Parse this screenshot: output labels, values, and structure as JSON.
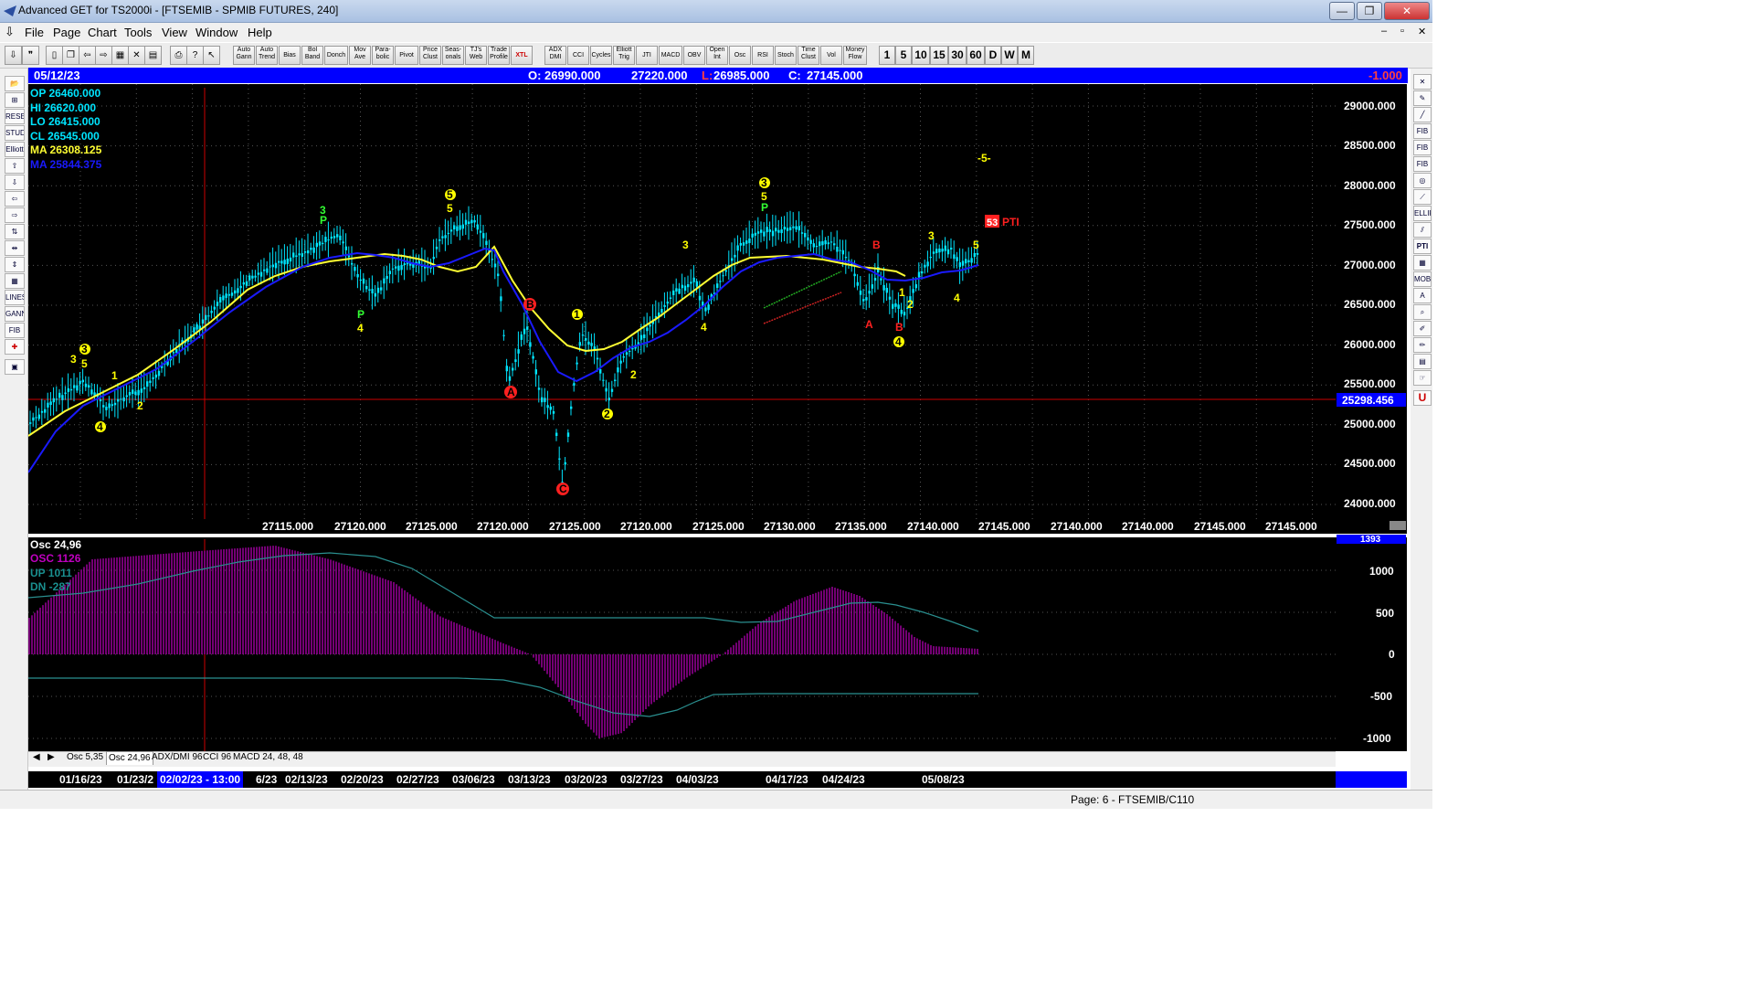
{
  "window": {
    "title": "Advanced GET for TS2000i - [FTSEMIB - SPMIB FUTURES, 240]",
    "buttons": {
      "minimize": "—",
      "maximize": "❐",
      "close": "✕"
    },
    "mdi_buttons": {
      "minimize": "–",
      "restore": "▫",
      "close": "✕"
    }
  },
  "menu": [
    "File",
    "Page",
    "Chart",
    "Tools",
    "View",
    "Window",
    "Help"
  ],
  "toolbar": {
    "indicators": [
      "Auto Gann",
      "Auto Trend",
      "Bias",
      "Bol Band",
      "Donch",
      "Mov Ave",
      "Para- bolic",
      "Pivot",
      "Price Clust",
      "Seas- onals",
      "TJ's Web",
      "Trade Profile",
      "XTL"
    ],
    "oscillators": [
      "ADX DMI",
      "CCI",
      "Cycles",
      "Elliott Trig",
      "JTI",
      "MACD",
      "OBV",
      "Open Int",
      "Osc",
      "RSI",
      "Stoch",
      "Time Clust",
      "Vol",
      "Money Flow"
    ],
    "intervals": [
      "1",
      "5",
      "10",
      "15",
      "30",
      "60",
      "D",
      "W",
      "M"
    ]
  },
  "left_tools": [
    "RESET",
    "STUDY",
    "Elliott",
    "LINES",
    "GANN",
    "FIB"
  ],
  "right_tools": [
    "FIB RET",
    "FIB EXT",
    "FIB TIME",
    "ELLIPS",
    "PTI",
    "MOB"
  ],
  "infobar": {
    "date": "05/12/23",
    "open_label": "O:",
    "open": "26990.000",
    "high": "27220.000",
    "low_label": "L:",
    "low": "26985.000",
    "close_label": "C:",
    "close": "27145.000",
    "change": "-1.000"
  },
  "legend": {
    "op": "OP  26460.000",
    "hi": "HI   26620.000",
    "lo": "LO   26415.000",
    "cl": "CL   26545.000",
    "ma1": "MA  26308.125",
    "ma2": "MA  25844.375"
  },
  "colors": {
    "background": "#000000",
    "candle": "#00e5ff",
    "ma_fast": "#ffff33",
    "ma_slow": "#1a1aff",
    "label_yellow": "#ffff00",
    "label_green": "#33ff33",
    "label_red": "#ff2020",
    "osc": "#c000c0",
    "osc_line": "#2a8f8f",
    "cursor": "#cc0000",
    "axis_text": "#ffffff"
  },
  "price_axis": {
    "ticks": [
      "29000.000",
      "28500.000",
      "28000.000",
      "27500.000",
      "27000.000",
      "26500.000",
      "26000.000",
      "25500.000",
      "25000.000",
      "24500.000",
      "24000.000"
    ],
    "cursor_price": "25298.456"
  },
  "bottom_values": [
    "27115.000",
    "27120.000",
    "27125.000",
    "27120.000",
    "27125.000",
    "27120.000",
    "27125.000",
    "27130.000",
    "27135.000",
    "27140.000",
    "27145.000",
    "27140.000",
    "27140.000",
    "27145.000",
    "27145.000"
  ],
  "wave_labels": {
    "w3a": "3",
    "w5a": "5",
    "w3a_c": "3",
    "w1a": "1",
    "w4a": "4",
    "w2a": "2",
    "w3b": "3",
    "pb": "P",
    "pb2": "P",
    "w4b": "4",
    "w5b_c": "5",
    "w5b": "5",
    "bB": "B",
    "aA": "A",
    "cC": "C",
    "w1b": "1",
    "w2b": "2",
    "w2b_c": "2",
    "w3c": "3",
    "w4c": "4",
    "w3d_c": "3",
    "w5d": "5",
    "pd": "P",
    "bA": "A",
    "bB2": "B",
    "w1c": "1",
    "w2c": "2",
    "bB3": "B",
    "w4c_c": "4",
    "w3e": "3",
    "w5e": "5",
    "w4e": "4",
    "w5_target": "-5-",
    "pti_num": "53",
    "pti": "PTI"
  },
  "osc": {
    "title": "Osc 24,96",
    "osc_label": "OSC 1126",
    "up_label": "UP   1011",
    "dn_label": "DN   -287",
    "ticks": [
      "1000",
      "500",
      "0",
      "-500",
      "-1000"
    ],
    "top_value": "1393"
  },
  "tabs": [
    "Osc 5,35",
    "Osc 24,96",
    "ADX/DMI 96",
    "CCI 96",
    "MACD 24, 48, 48"
  ],
  "dates": [
    "01/16/23",
    "01/23/2",
    "02/02/23 - 13:00",
    "6/23",
    "02/13/23",
    "02/20/23",
    "02/27/23",
    "03/06/23",
    "03/13/23",
    "03/20/23",
    "03/27/23",
    "04/03/23",
    "04/17/23",
    "04/24/23",
    "05/08/23"
  ],
  "status": "Page: 6 - FTSEMIB/C110"
}
